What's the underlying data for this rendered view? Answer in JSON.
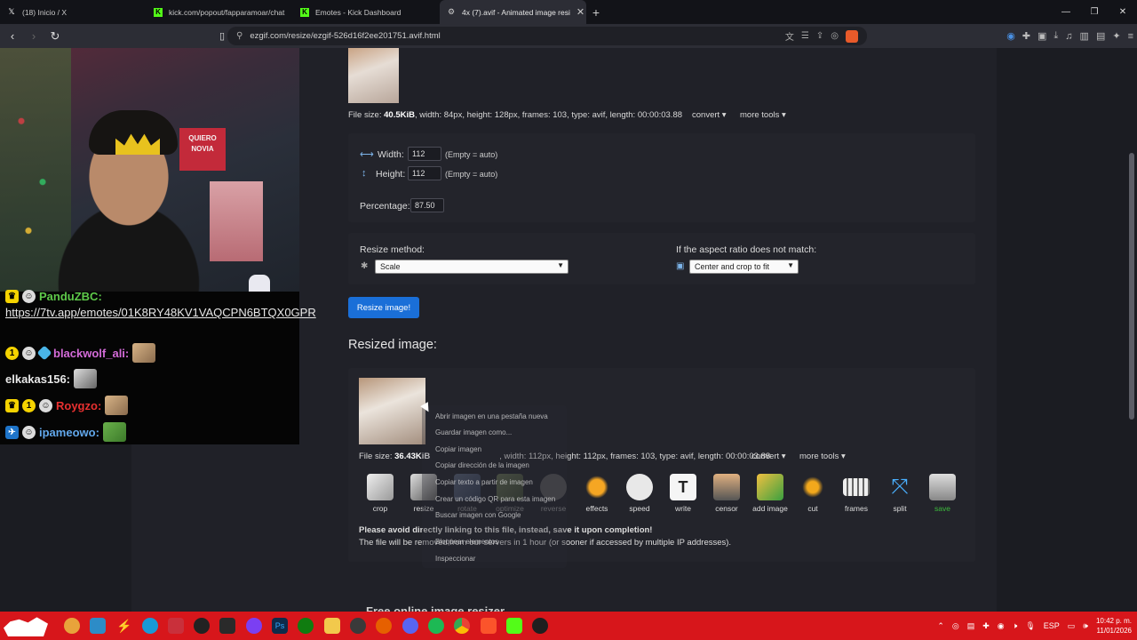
{
  "browser": {
    "tabs": [
      {
        "title": "(18) Inicio / X",
        "favicon": "x-icon"
      },
      {
        "title": "kick.com/popout/fapparamoar/chat",
        "favicon": "kick-icon"
      },
      {
        "title": "Emotes - Kick Dashboard",
        "favicon": "kick-icon"
      },
      {
        "title": "4x (7).avif - Animated image resi",
        "favicon": "ezgif-icon",
        "active": true
      }
    ],
    "url": "ezgif.com/resize/ezgif-526d16f2ee201751.avif.html"
  },
  "stream": {
    "sign_text": "QUIERO NOVIA",
    "chat": {
      "lines": [
        {
          "user": "PanduZBC:",
          "color": "#5ec94a"
        },
        {
          "user": "blackwolf_ali:",
          "color": "#d46bd9"
        },
        {
          "user": "elkakas156:",
          "color": "#e8e8e8"
        },
        {
          "user": "Roygzo:",
          "color": "#e83030"
        },
        {
          "user": "ipameowo:",
          "color": "#62a8ec"
        }
      ],
      "link": "https://7tv.app/emotes/01K8RY48KV1VAQCPN6BTQX0GPR"
    }
  },
  "source": {
    "file_size_label": "File size:",
    "file_size": "40.5KiB",
    "details": ", width: 84px, height: 128px, frames: 103, type: avif, length: 00:00:03.88",
    "convert": "convert",
    "more_tools": "more tools"
  },
  "form": {
    "width_label": "Width:",
    "width_value": "112",
    "height_label": "Height:",
    "height_value": "112",
    "empty_auto": "(Empty = auto)",
    "percentage_label": "Percentage:",
    "percentage_value": "87.50",
    "method_label": "Resize method:",
    "method_value": "Scale",
    "aspect_label": "If the aspect ratio does not match:",
    "aspect_value": "Center and crop to fit",
    "submit": "Resize image!"
  },
  "result": {
    "title": "Resized image:",
    "file_size_label": "File size:",
    "file_size": "36.43KiB",
    "details_tail": ", width: 112px, height: 112px, frames: 103, type: avif, length: 00:00:03.88",
    "convert": "convert",
    "more_tools": "more tools",
    "tools": [
      "crop",
      "resize",
      "rotate",
      "optimize",
      "reverse",
      "effects",
      "speed",
      "write",
      "censor",
      "add image",
      "cut",
      "frames",
      "split",
      "save"
    ],
    "notice_bold": "Please avoid directly linking to this file, instead, save it upon completion!",
    "notice": "The file will be removed from our servers in 1 hour (or sooner if accessed by multiple IP addresses)."
  },
  "context_menu": {
    "items": [
      "Abrir imagen en una pestaña nueva",
      "Guardar imagen como...",
      "Copiar imagen",
      "Copiar dirección de la imagen",
      "Copiar texto a partir de imagen",
      "Crear un código QR para esta imagen",
      "Buscar imagen con Google",
      "Bloquear elementos",
      "Inspeccionar"
    ]
  },
  "below_heading": "Free online image resizer",
  "taskbar": {
    "lang": "ESP",
    "time": "10:42 p. m.",
    "date": "11/01/2026"
  }
}
